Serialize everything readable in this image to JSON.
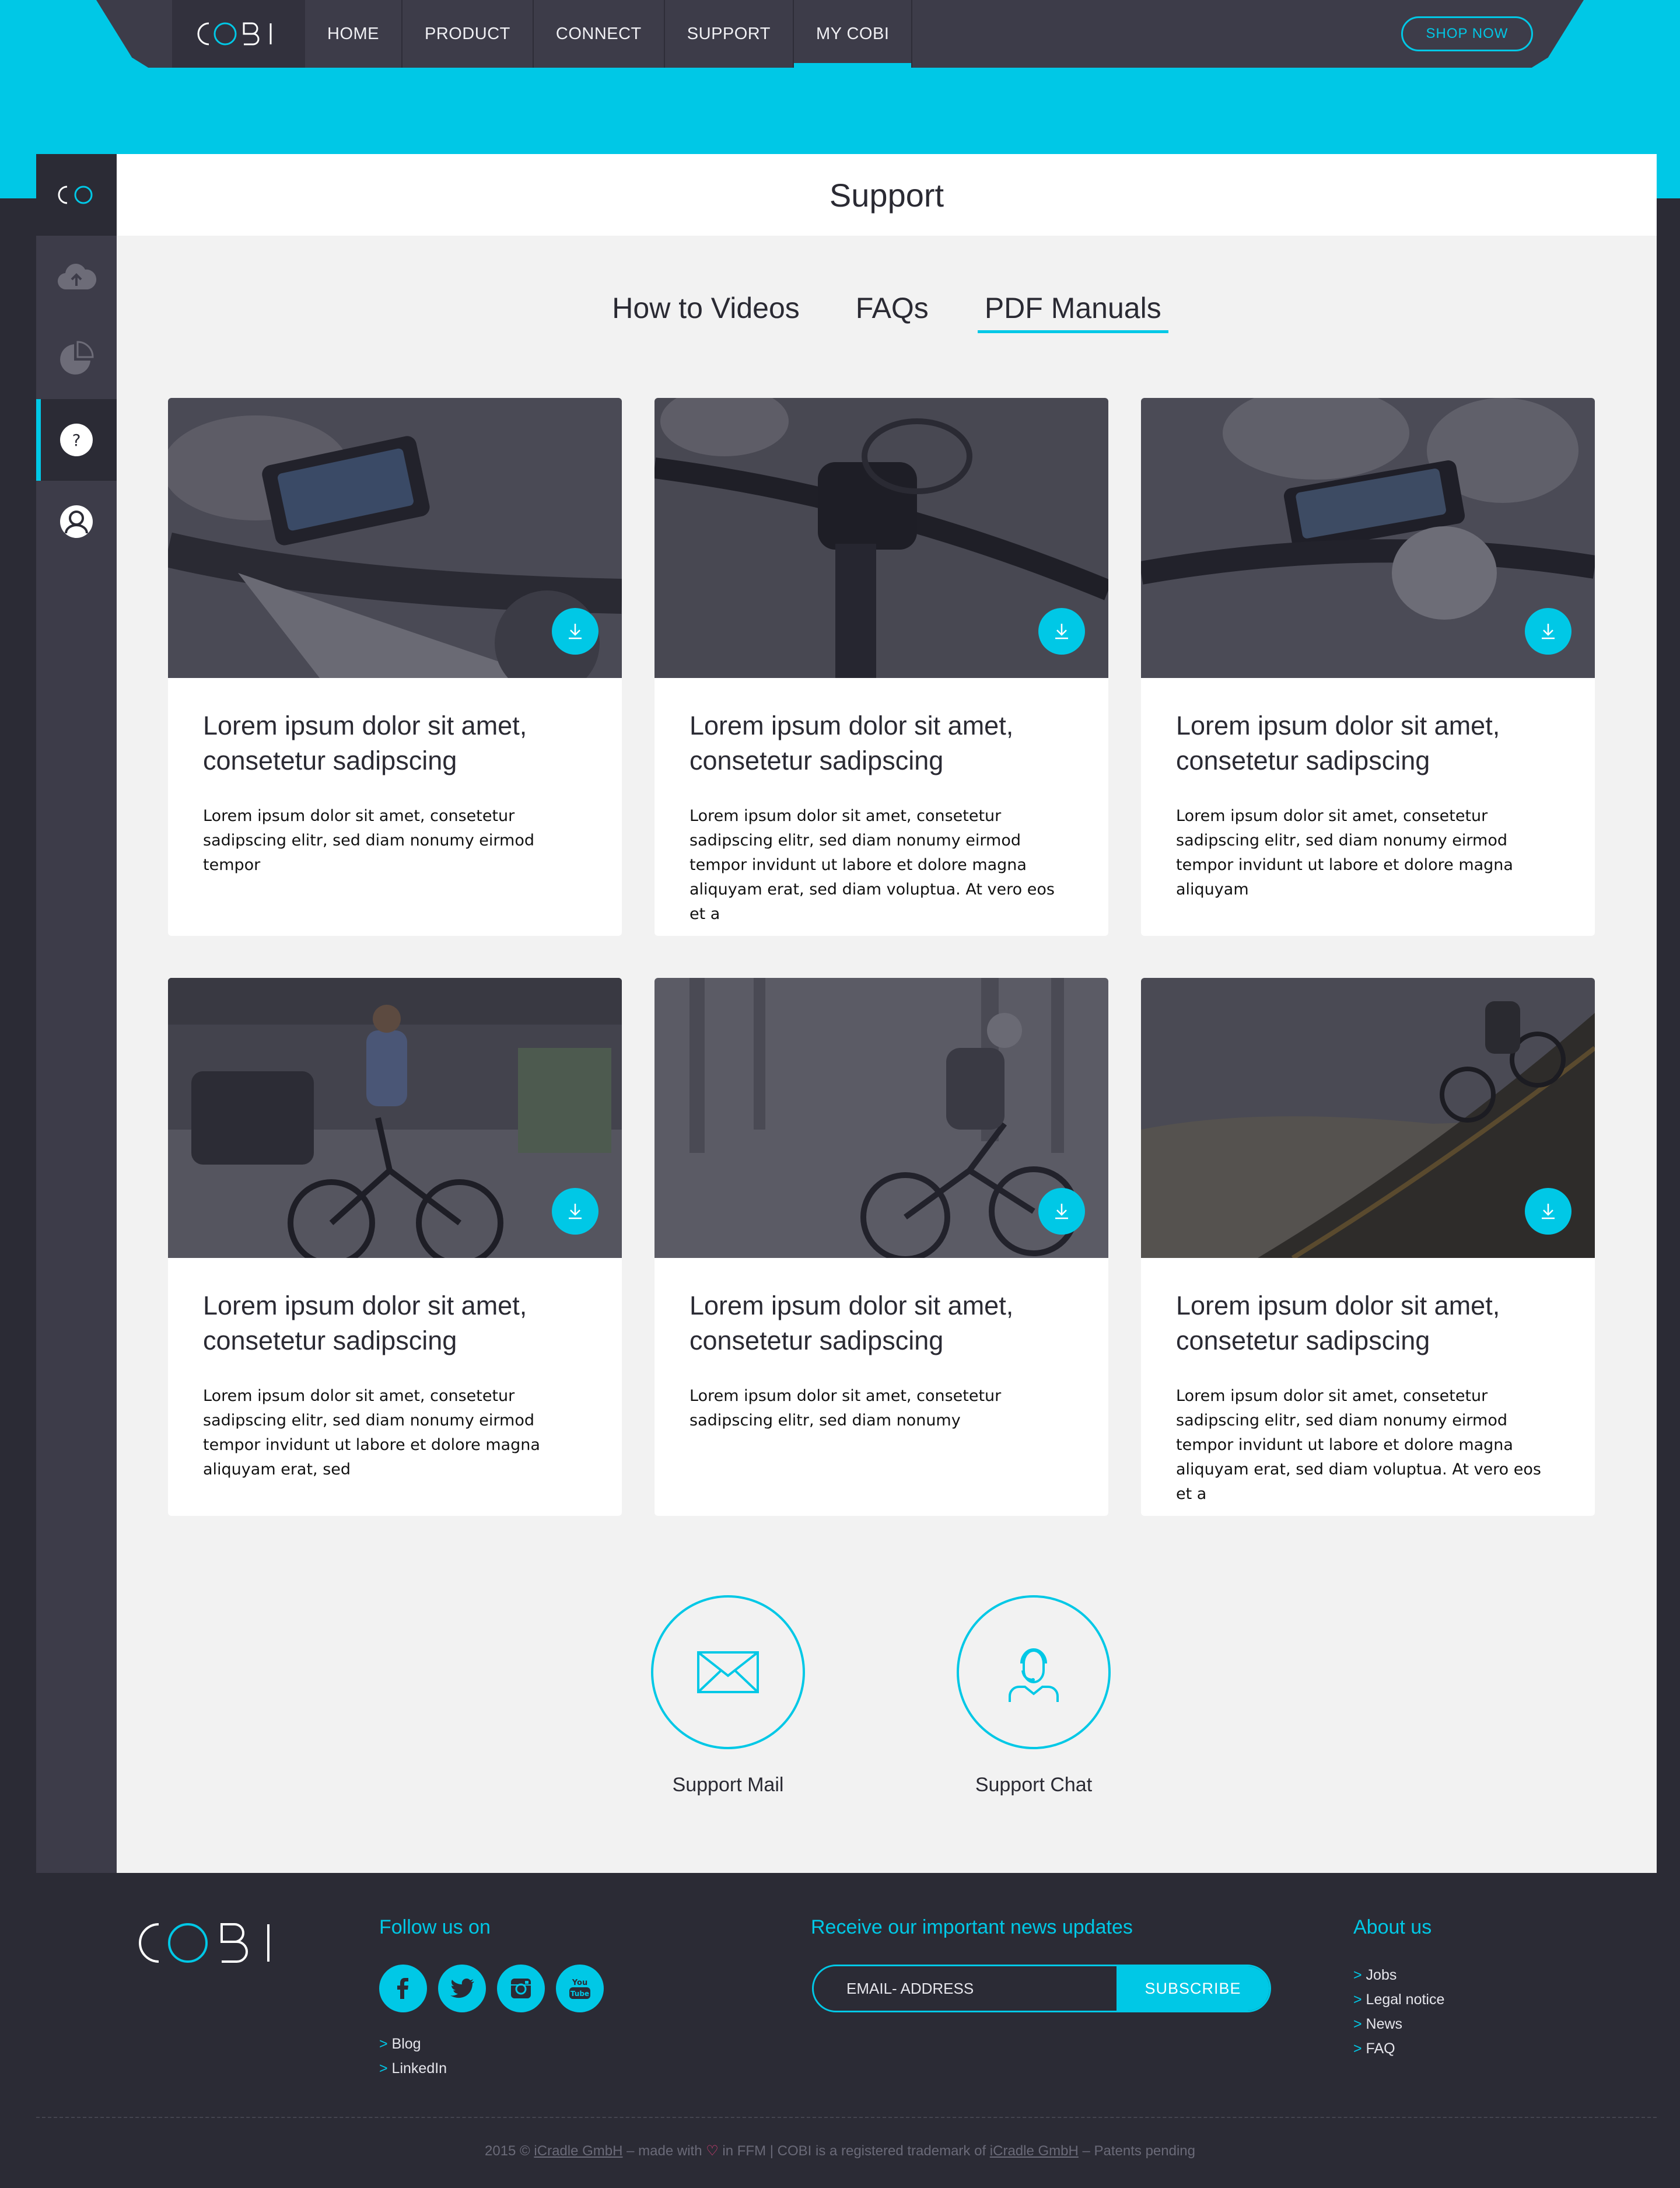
{
  "brand": {
    "logo_text": "COBI",
    "accent_color": "#00c8e6"
  },
  "nav": {
    "items": [
      {
        "label": "HOME"
      },
      {
        "label": "PRODUCT"
      },
      {
        "label": "CONNECT"
      },
      {
        "label": "SUPPORT"
      },
      {
        "label": "MY COBI",
        "active": true
      }
    ],
    "shop_label": "SHOP NOW"
  },
  "sidebar": {
    "items": [
      {
        "icon": "cloud-upload-icon"
      },
      {
        "icon": "pie-chart-icon"
      },
      {
        "icon": "help-icon",
        "glyph": "?",
        "active": true
      },
      {
        "icon": "user-icon"
      }
    ]
  },
  "page": {
    "title": "Support"
  },
  "tabs": [
    {
      "label": "How to Videos"
    },
    {
      "label": "FAQs"
    },
    {
      "label": "PDF Manuals",
      "active": true
    }
  ],
  "cards": [
    {
      "title": "Lorem ipsum dolor sit amet, consetetur sadipscing",
      "text": "Lorem ipsum dolor sit amet, consetetur sadipscing elitr, sed diam nonumy eirmod tempor",
      "image": "hands holding phone on bike handlebar"
    },
    {
      "title": "Lorem ipsum dolor sit amet, consetetur sadipscing",
      "text": "Lorem ipsum dolor sit amet, consetetur sadipscing elitr, sed diam nonumy eirmod tempor invidunt ut labore et dolore magna aliquyam erat, sed diam voluptua. At vero eos et a",
      "image": "bike mount on handlebar"
    },
    {
      "title": "Lorem ipsum dolor sit amet, consetetur sadipscing",
      "text": "Lorem ipsum dolor sit amet, consetetur sadipscing elitr, sed diam nonumy eirmod tempor invidunt ut labore et dolore magna aliquyam",
      "image": "attaching phone to bike mount"
    },
    {
      "title": "Lorem ipsum dolor sit amet, consetetur sadipscing",
      "text": "Lorem ipsum dolor sit amet, consetetur sadipscing elitr, sed diam nonumy eirmod tempor invidunt ut labore et dolore magna aliquyam erat, sed",
      "image": "city cyclist"
    },
    {
      "title": "Lorem ipsum dolor sit amet, consetetur sadipscing",
      "text": "Lorem ipsum dolor sit amet, consetetur sadipscing elitr, sed diam nonumy",
      "image": "mountain biker in forest"
    },
    {
      "title": "Lorem ipsum dolor sit amet, consetetur sadipscing",
      "text": "Lorem ipsum dolor sit amet, consetetur sadipscing elitr, sed diam nonumy eirmod tempor invidunt ut labore et dolore magna aliquyam erat, sed diam voluptua. At vero eos et a",
      "image": "mountain biker on hillside at sunset"
    }
  ],
  "support": {
    "mail_label": "Support Mail",
    "chat_label": "Support Chat"
  },
  "footer": {
    "follow_heading": "Follow us on",
    "social": [
      {
        "icon": "facebook-icon"
      },
      {
        "icon": "twitter-icon"
      },
      {
        "icon": "instagram-icon"
      },
      {
        "icon": "youtube-icon"
      }
    ],
    "follow_links": [
      "Blog",
      "LinkedIn"
    ],
    "news_heading": "Receive our important news updates",
    "email_placeholder": "EMAIL- ADDRESS",
    "subscribe_label": "SUBSCRIBE",
    "about_heading": "About us",
    "about_links": [
      "Jobs",
      "Legal notice",
      "News",
      "FAQ"
    ],
    "copyright": {
      "part1": "2015 ©",
      "link1": "iCradle GmbH",
      "part2": "– made with",
      "part3": "in FFM | COBI is a registered trademark of",
      "link2": "iCradle GmbH",
      "part4": "– Patents pending"
    }
  }
}
